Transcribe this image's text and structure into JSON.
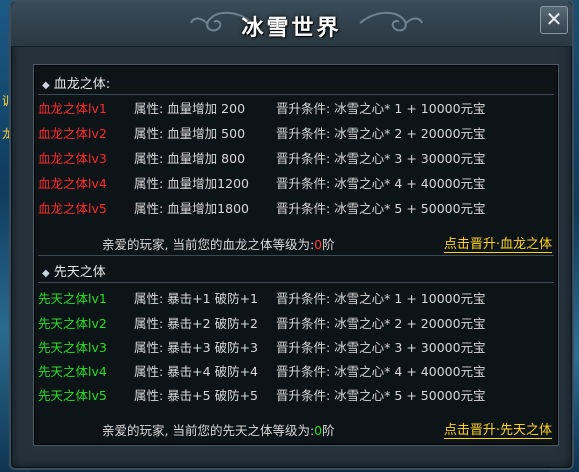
{
  "window": {
    "title": "冰雪世界",
    "close_label": "✕"
  },
  "bloodline": {
    "header": "血龙之体:",
    "rows": [
      {
        "name": "血龙之体lv1",
        "attr": "属性: 血量增加 200",
        "cond": "晋升条件: 冰雪之心* 1 + 10000元宝"
      },
      {
        "name": "血龙之体lv2",
        "attr": "属性: 血量增加 500",
        "cond": "晋升条件: 冰雪之心* 2 + 20000元宝"
      },
      {
        "name": "血龙之体lv3",
        "attr": "属性: 血量增加 800",
        "cond": "晋升条件: 冰雪之心* 3 + 30000元宝"
      },
      {
        "name": "血龙之体lv4",
        "attr": "属性: 血量增加1200",
        "cond": "晋升条件: 冰雪之心* 4 + 40000元宝"
      },
      {
        "name": "血龙之体lv5",
        "attr": "属性: 血量增加1800",
        "cond": "晋升条件: 冰雪之心* 5 + 50000元宝"
      }
    ],
    "summary_prefix": "亲爱的玩家, 当前您的血龙之体等级为:",
    "summary_level": "0",
    "summary_suffix": "阶",
    "upgrade_link": "点击晋升·血龙之体"
  },
  "innate": {
    "header": "先天之体",
    "rows": [
      {
        "name": "先天之体lv1",
        "attr": "属性: 暴击+1 破防+1",
        "cond": "晋升条件: 冰雪之心* 1 + 10000元宝"
      },
      {
        "name": "先天之体lv2",
        "attr": "属性: 暴击+2 破防+2",
        "cond": "晋升条件: 冰雪之心* 2 + 20000元宝"
      },
      {
        "name": "先天之体lv3",
        "attr": "属性: 暴击+3 破防+3",
        "cond": "晋升条件: 冰雪之心* 3 + 30000元宝"
      },
      {
        "name": "先天之体lv4",
        "attr": "属性: 暴击+4 破防+4",
        "cond": "晋升条件: 冰雪之心* 4 + 40000元宝"
      },
      {
        "name": "先天之体lv5",
        "attr": "属性: 暴击+5 破防+5",
        "cond": "晋升条件: 冰雪之心* 5 + 50000元宝"
      }
    ],
    "summary_prefix": "亲爱的玩家, 当前您的先天之体等级为:",
    "summary_level": "0",
    "summary_suffix": "阶",
    "upgrade_link": "点击晋升·先天之体"
  },
  "background": {
    "left_text_1": "训",
    "left_text_2": "龙"
  },
  "colors": {
    "red_name": "#ff2a2a",
    "green_name": "#22e022",
    "link": "#ffd21e"
  },
  "icons": {
    "close": "close-icon",
    "bullet": "diamond-bullet-icon"
  }
}
